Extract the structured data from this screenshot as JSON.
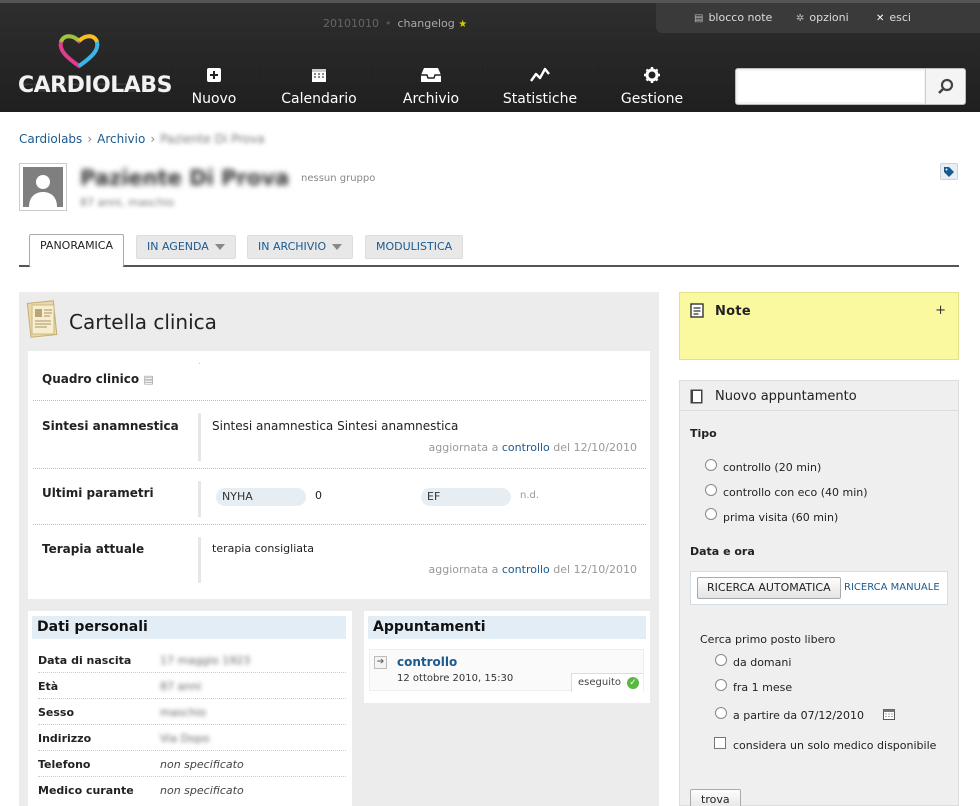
{
  "app": {
    "logo_text": "CARDIOLABS",
    "version": "20101010",
    "changelog_label": "changelog"
  },
  "util_menu": [
    {
      "icon": "notepad-icon",
      "label": "blocco note"
    },
    {
      "icon": "gear-icon",
      "label": "opzioni"
    },
    {
      "icon": "close-icon",
      "label": "esci"
    }
  ],
  "nav": [
    {
      "icon": "plus-square-icon",
      "label": "Nuovo"
    },
    {
      "icon": "calendar-icon",
      "label": "Calendario"
    },
    {
      "icon": "inbox-icon",
      "label": "Archivio"
    },
    {
      "icon": "line-chart-icon",
      "label": "Statistiche"
    },
    {
      "icon": "gear-icon",
      "label": "Gestione"
    }
  ],
  "search": {
    "placeholder": "",
    "value": ""
  },
  "breadcrumb": [
    "Cardiolabs",
    "Archivio",
    "Paziente Di Prova"
  ],
  "patient": {
    "name": "Paziente Di Prova",
    "group": "nessun gruppo",
    "info": "87 anni, maschio"
  },
  "tabs": [
    {
      "label": "PANORAMICA",
      "active": true
    },
    {
      "label": "IN AGENDA",
      "dropdown": true
    },
    {
      "label": "IN ARCHIVIO",
      "dropdown": true
    },
    {
      "label": "MODULISTICA"
    }
  ],
  "cartella": {
    "title": "Cartella clinica",
    "quadro_label": "Quadro clinico",
    "quadro_value": "·",
    "sintesi_label": "Sintesi anamnestica",
    "sintesi_value": "Sintesi anamnestica Sintesi anamnestica",
    "sintesi_meta_pre": "aggiornata a",
    "sintesi_meta_link": "controllo",
    "sintesi_meta_post": "del 12/10/2010",
    "param_label": "Ultimi parametri",
    "param1_name": "NYHA",
    "param1_value": "0",
    "param2_name": "EF",
    "param2_value": "n.d.",
    "terapia_label": "Terapia attuale",
    "terapia_value": "terapia consigliata",
    "terapia_meta_pre": "aggiornata a",
    "terapia_meta_link": "controllo",
    "terapia_meta_post": "del 12/10/2010"
  },
  "dati_personali": {
    "title": "Dati personali",
    "rows": [
      {
        "k": "Data di nascita",
        "v": "17 maggio 1923"
      },
      {
        "k": "Età",
        "v": "87 anni"
      },
      {
        "k": "Sesso",
        "v": "maschio"
      },
      {
        "k": "Indirizzo",
        "v": "Via Dopo"
      },
      {
        "k": "Telefono",
        "v": "non specificato"
      },
      {
        "k": "Medico curante",
        "v": "non specificato"
      }
    ]
  },
  "appuntamenti": {
    "title": "Appuntamenti",
    "item_title": "controllo",
    "item_date": "12 ottobre 2010, 15:30",
    "item_status": "eseguito"
  },
  "note": {
    "title": "Note",
    "add": "+"
  },
  "nuovo_appuntamento": {
    "title": "Nuovo appuntamento",
    "tipo_label": "Tipo",
    "tipi": [
      "controllo (20 min)",
      "controllo con eco (40 min)",
      "prima visita (60 min)"
    ],
    "data_label": "Data e ora",
    "auto_button": "RICERCA AUTOMATICA",
    "manual_link": "RICERCA MANUALE",
    "cerca_label": "Cerca primo posto libero",
    "opzioni": [
      "da domani",
      "fra 1 mese",
      "a partire da 07/12/2010"
    ],
    "solo_medico": "considera un solo medico disponibile",
    "trova": "trova"
  }
}
